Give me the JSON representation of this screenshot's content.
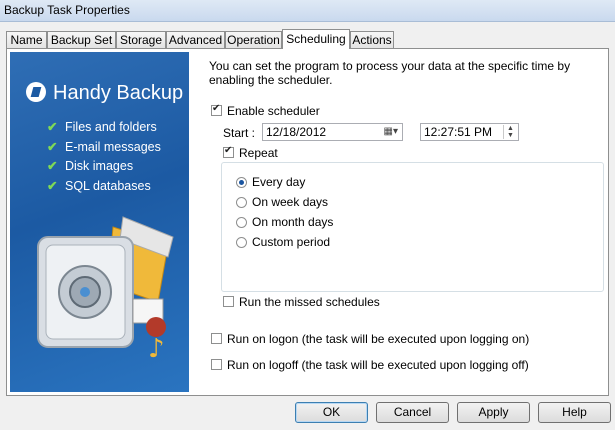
{
  "window": {
    "title": "Backup Task Properties"
  },
  "tabs": [
    {
      "label": "Name"
    },
    {
      "label": "Backup Set"
    },
    {
      "label": "Storage"
    },
    {
      "label": "Advanced"
    },
    {
      "label": "Operation"
    },
    {
      "label": "Scheduling"
    },
    {
      "label": "Actions"
    }
  ],
  "active_tab": "Scheduling",
  "banner": {
    "brand": "Handy Backup",
    "features": [
      "Files and folders",
      "E-mail messages",
      "Disk images",
      "SQL databases"
    ]
  },
  "scheduling": {
    "intro": "You can set the program to process your data at the specific time by enabling the scheduler.",
    "enable_scheduler": {
      "label": "Enable scheduler",
      "checked": true
    },
    "start_label": "Start :",
    "start_date": "12/18/2012",
    "start_time": "12:27:51 PM",
    "repeat": {
      "label": "Repeat",
      "checked": true
    },
    "repeat_options": [
      {
        "label": "Every day",
        "selected": true
      },
      {
        "label": "On week days",
        "selected": false
      },
      {
        "label": "On month days",
        "selected": false
      },
      {
        "label": "Custom period",
        "selected": false
      }
    ],
    "missed": {
      "label": "Run the missed schedules",
      "checked": false
    },
    "logon": {
      "label": "Run on logon (the task will be executed upon logging on)",
      "checked": false
    },
    "logoff": {
      "label": "Run on logoff (the task will be executed upon logging off)",
      "checked": false
    }
  },
  "buttons": {
    "ok": "OK",
    "cancel": "Cancel",
    "apply": "Apply",
    "help": "Help"
  },
  "colors": {
    "banner": "#1c5aa3",
    "check": "#7ed957"
  }
}
